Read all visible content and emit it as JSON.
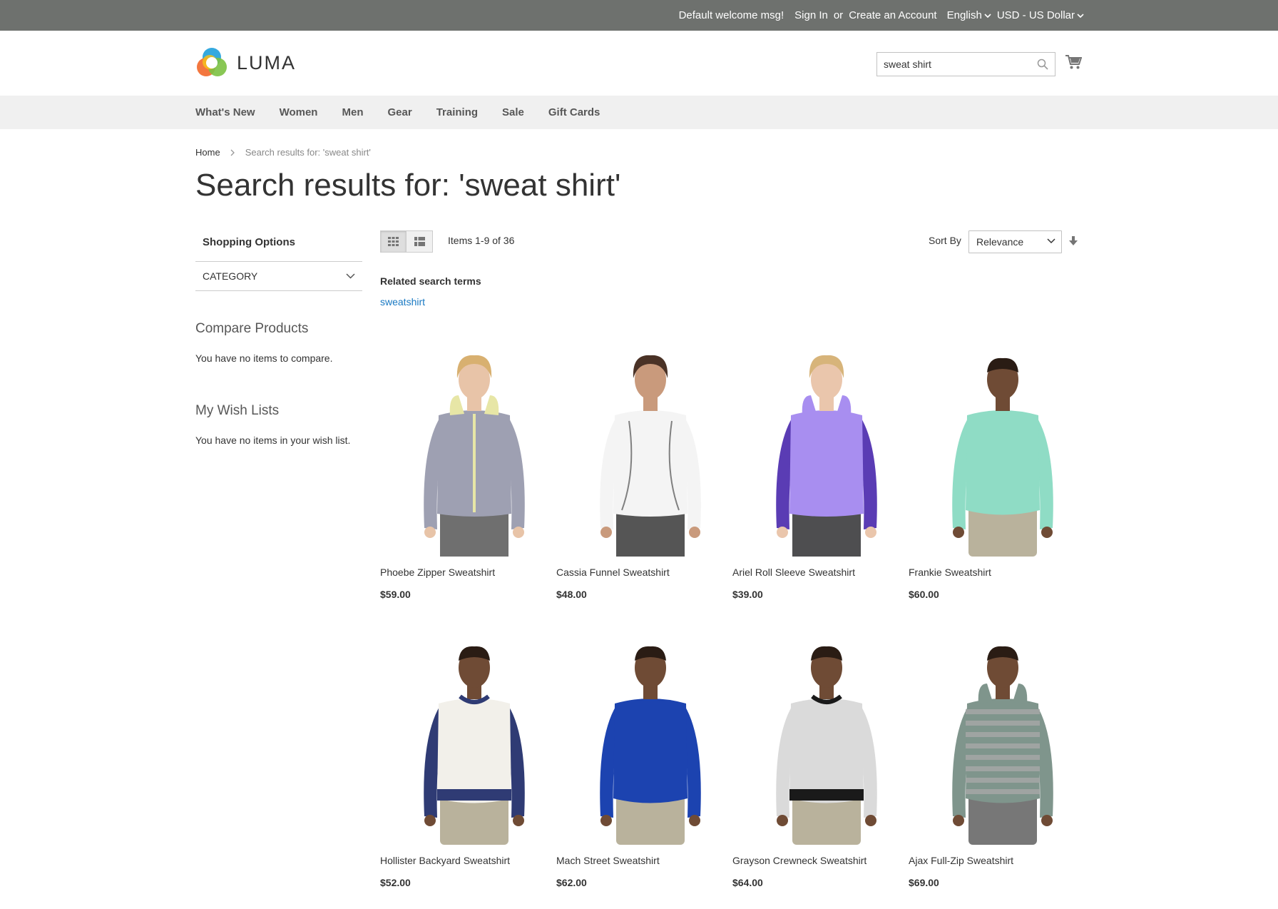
{
  "top_bar": {
    "welcome": "Default welcome msg!",
    "sign_in": "Sign In",
    "or": "or",
    "create_account": "Create an Account",
    "language": "English",
    "currency": "USD - US Dollar"
  },
  "header": {
    "logo_text": "LUMA",
    "search_value": "sweat shirt"
  },
  "nav": [
    "What's New",
    "Women",
    "Men",
    "Gear",
    "Training",
    "Sale",
    "Gift Cards"
  ],
  "breadcrumb": {
    "home": "Home",
    "current": "Search results for: 'sweat shirt'"
  },
  "page_title": "Search results for: 'sweat shirt'",
  "sidebar": {
    "shopping_options": "Shopping Options",
    "category": "CATEGORY",
    "compare_title": "Compare Products",
    "compare_text": "You have no items to compare.",
    "wish_title": "My Wish Lists",
    "wish_text": "You have no items in your wish list."
  },
  "toolbar": {
    "amount": "Items 1-9 of 36",
    "sort_label": "Sort By",
    "sort_value": "Relevance"
  },
  "related": {
    "title": "Related search terms",
    "term": "sweatshirt"
  },
  "products": [
    {
      "name": "Phoebe Zipper Sweatshirt",
      "price": "$59.00",
      "color": "#9ea0b2",
      "accent": "#e7e6a6",
      "skin": "#e8c4a8",
      "hair": "#d8b070",
      "bottom": "#6f6f6f"
    },
    {
      "name": "Cassia Funnel Sweatshirt",
      "price": "$48.00",
      "color": "#f4f4f4",
      "accent": "#808080",
      "skin": "#c99a7c",
      "hair": "#4a3226",
      "bottom": "#555"
    },
    {
      "name": "Ariel Roll Sleeve Sweatshirt",
      "price": "$39.00",
      "color": "#a88ef0",
      "accent": "#5a3cb4",
      "skin": "#eac6ac",
      "hair": "#d7b47a",
      "bottom": "#4e4e50"
    },
    {
      "name": "Frankie Sweatshirt",
      "price": "$60.00",
      "color": "#8fdcc5",
      "accent": "#8fdcc5",
      "skin": "#6f4b35",
      "hair": "#2a1c14",
      "bottom": "#b9b29c"
    },
    {
      "name": "Hollister Backyard Sweatshirt",
      "price": "$52.00",
      "color": "#f2f0ea",
      "accent": "#2f3b74",
      "skin": "#6f4b35",
      "hair": "#2a1c14",
      "bottom": "#b9b29c"
    },
    {
      "name": "Mach Street Sweatshirt",
      "price": "$62.00",
      "color": "#1c43b0",
      "accent": "#1c43b0",
      "skin": "#6f4b35",
      "hair": "#2a1c14",
      "bottom": "#b9b29c"
    },
    {
      "name": "Grayson Crewneck Sweatshirt",
      "price": "$64.00",
      "color": "#dadada",
      "accent": "#1a1a1a",
      "skin": "#6f4b35",
      "hair": "#2a1c14",
      "bottom": "#b9b29c"
    },
    {
      "name": "Ajax Full-Zip Sweatshirt",
      "price": "$69.00",
      "color": "#7f958c",
      "accent": "#a8a8a8",
      "skin": "#6f4b35",
      "hair": "#2a1c14",
      "bottom": "#777"
    }
  ]
}
